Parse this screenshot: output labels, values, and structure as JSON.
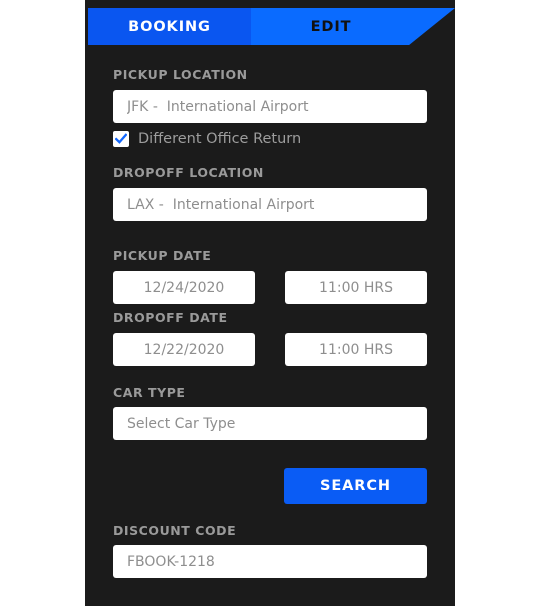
{
  "tabs": [
    {
      "label": "BOOKING",
      "active": true
    },
    {
      "label": "EDIT",
      "active": false
    }
  ],
  "colors": {
    "panel_background": "#1b1b1b",
    "tab_active": "#0a56f0",
    "tab_inactive": "#0a6bff",
    "accent_blue": "#0a5cf5",
    "label_gray": "#9a9a9a",
    "placeholder_gray": "#8e8e8e",
    "field_white": "#ffffff"
  },
  "fields": {
    "pickup_location": {
      "label": "PICKUP LOCATION",
      "placeholder": "JFK -  International Airport",
      "value": ""
    },
    "different_office_return": {
      "label": "Different Office Return",
      "checked": true,
      "icon": "checkmark-icon"
    },
    "dropoff_location": {
      "label": "DROPOFF LOCATION",
      "placeholder": "LAX -  International Airport",
      "value": ""
    },
    "pickup_date": {
      "label": "PICKUP DATE",
      "date_value": "12/24/2020",
      "time_value": "11:00 HRS"
    },
    "dropoff_date": {
      "label": "DROPOFF DATE",
      "date_value": "12/22/2020",
      "time_value": "11:00 HRS"
    },
    "car_type": {
      "label": "CAR TYPE",
      "placeholder": "Select Car Type",
      "value": ""
    },
    "discount_code": {
      "label": "DISCOUNT CODE",
      "placeholder": "FBOOK-1218",
      "value": ""
    }
  },
  "actions": {
    "search_label": "SEARCH"
  }
}
